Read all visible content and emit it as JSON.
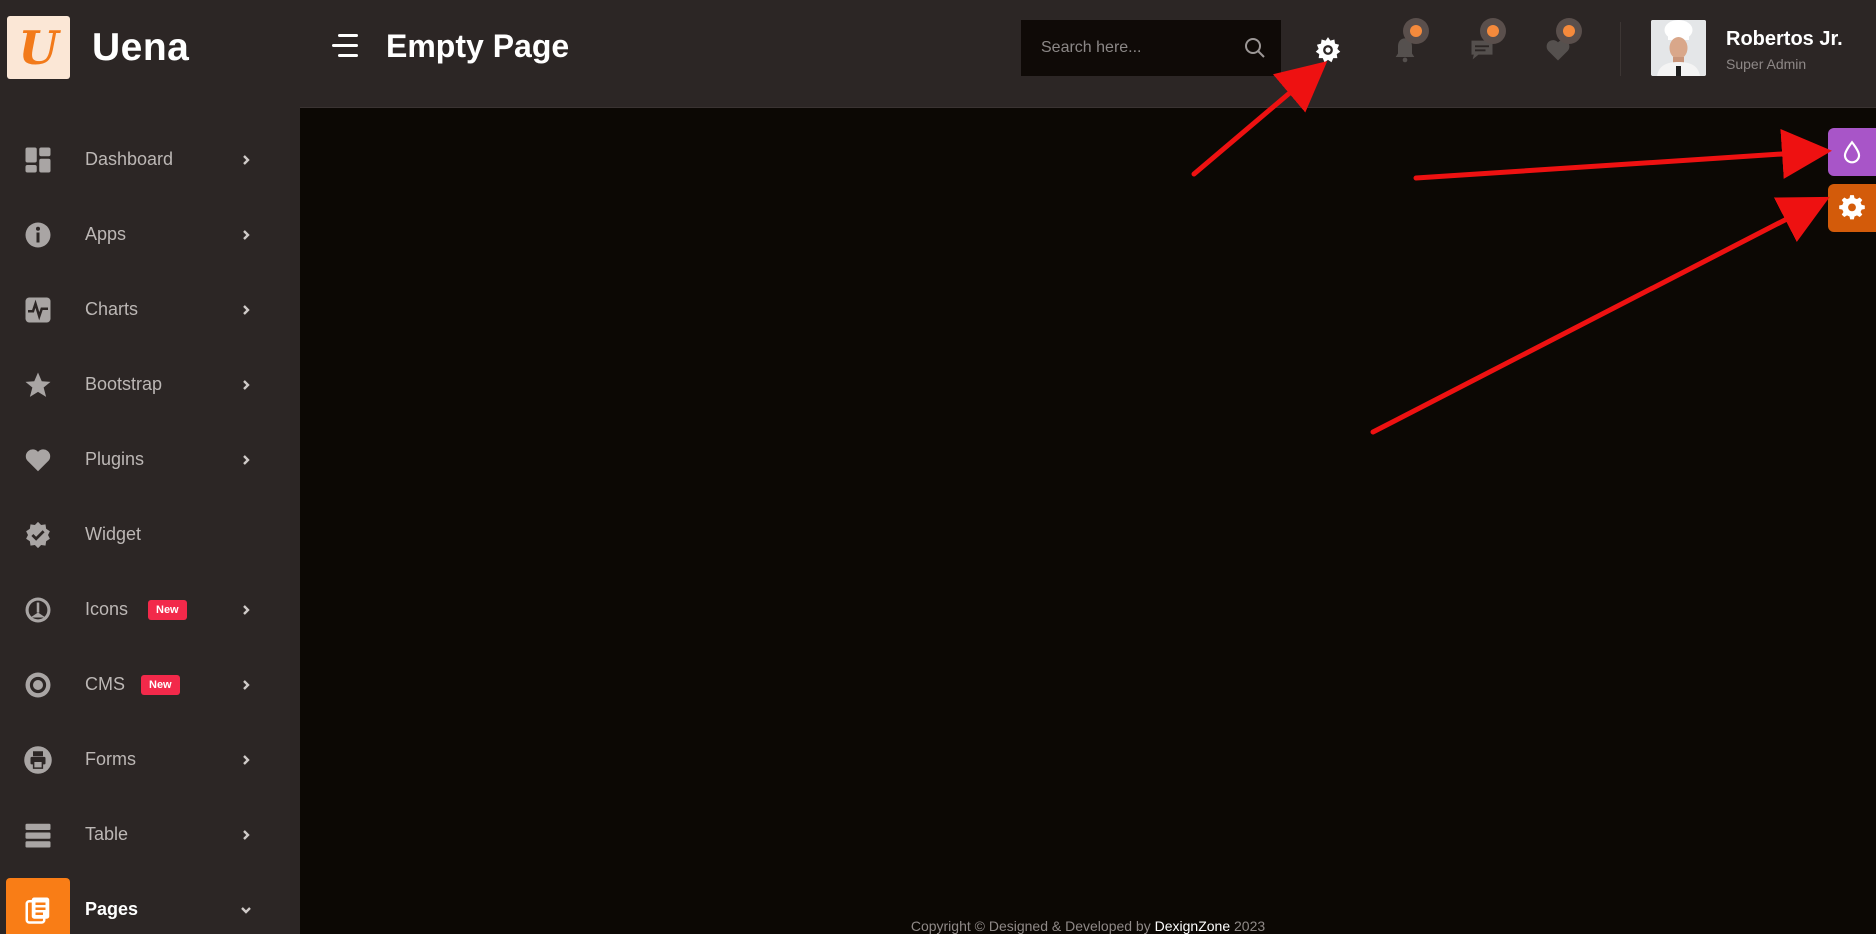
{
  "brand": {
    "logo_letter": "U",
    "name": "Uena"
  },
  "header": {
    "title": "Empty Page",
    "search_placeholder": "Search here...",
    "user": {
      "name": "Robertos Jr.",
      "role": "Super Admin"
    }
  },
  "sidebar": {
    "items": [
      {
        "label": "Dashboard",
        "icon": "dashboard-icon"
      },
      {
        "label": "Apps",
        "icon": "info-icon"
      },
      {
        "label": "Charts",
        "icon": "pulse-chart-icon"
      },
      {
        "label": "Bootstrap",
        "icon": "star-icon"
      },
      {
        "label": "Plugins",
        "icon": "heart-icon"
      },
      {
        "label": "Widget",
        "icon": "badge-check-icon"
      },
      {
        "label": "Icons",
        "icon": "gauge-icon",
        "badge": "New"
      },
      {
        "label": "CMS",
        "icon": "target-icon",
        "badge": "New"
      },
      {
        "label": "Forms",
        "icon": "printer-icon"
      },
      {
        "label": "Table",
        "icon": "layers-icon"
      },
      {
        "label": "Pages",
        "icon": "pages-icon"
      }
    ]
  },
  "footer": {
    "prefix": "Copyright © Designed & Developed by",
    "company": "DexignZone",
    "year": "2023"
  },
  "colors": {
    "accent": "#f97d16",
    "sidebar_bg": "#2c2625",
    "content_bg": "#0c0804",
    "badge": "#f2294a",
    "theme_button": "#a855c8",
    "settings_button": "#d35b0a",
    "annotation_arrow": "#ee1111"
  }
}
